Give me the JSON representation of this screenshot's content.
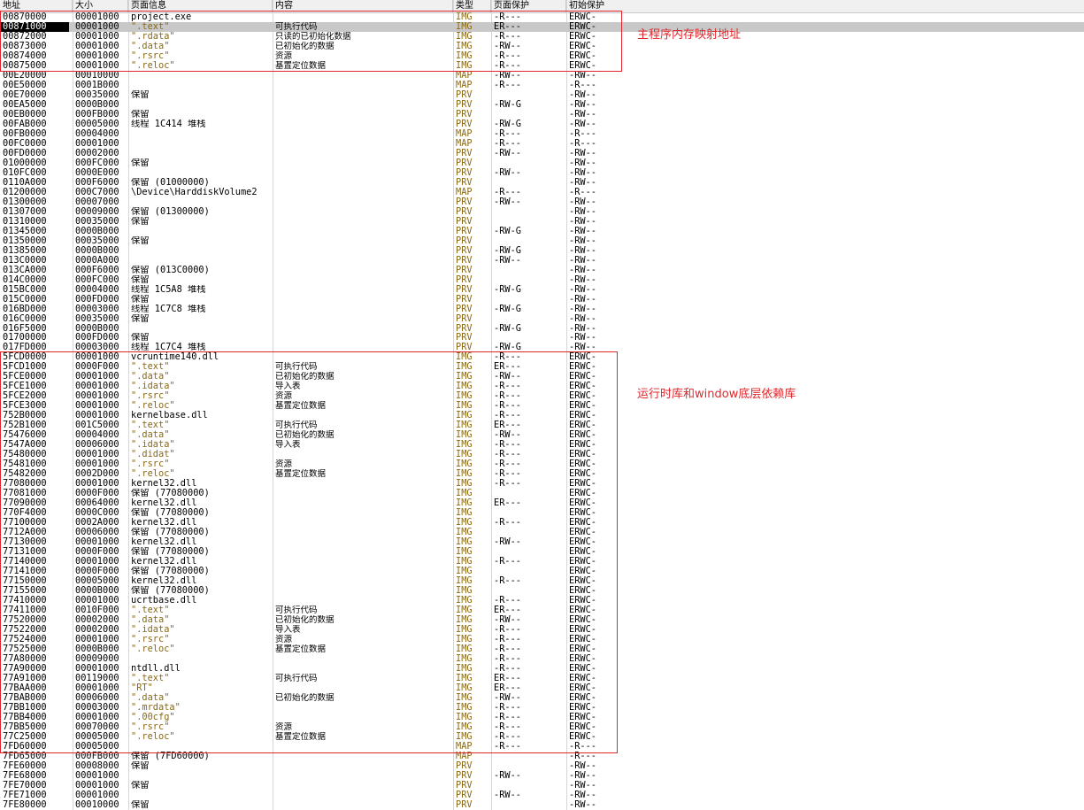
{
  "columns": {
    "address": "地址",
    "size": "大小",
    "page_info": "页面信息",
    "content": "内容",
    "type": "类型",
    "protection": "页面保护",
    "initial_protection": "初始保护"
  },
  "annotations": {
    "main_module": "主程序内存映射地址",
    "runtime_libs": "运行时库和window底层依赖库"
  },
  "colors": {
    "annotation": "#e0262b",
    "selection": "#c8c8c8",
    "type_text": "#8b6914"
  },
  "rows": [
    {
      "addr": "00870000",
      "size": "00001000",
      "info": "project.exe",
      "content": "",
      "type": "IMG",
      "prot": "-R---",
      "init": "ERWC-"
    },
    {
      "addr": "00871000",
      "size": "00001000",
      "info": " \".text\"",
      "content": "可执行代码",
      "type": "IMG",
      "prot": "ER---",
      "init": "ERWC-",
      "selected": true
    },
    {
      "addr": "00872000",
      "size": "00001000",
      "info": " \".rdata\"",
      "content": "只读的已初始化数据",
      "type": "IMG",
      "prot": "-R---",
      "init": "ERWC-"
    },
    {
      "addr": "00873000",
      "size": "00001000",
      "info": " \".data\"",
      "content": "已初始化的数据",
      "type": "IMG",
      "prot": "-RW--",
      "init": "ERWC-"
    },
    {
      "addr": "00874000",
      "size": "00001000",
      "info": " \".rsrc\"",
      "content": "资源",
      "type": "IMG",
      "prot": "-R---",
      "init": "ERWC-"
    },
    {
      "addr": "00875000",
      "size": "00001000",
      "info": " \".reloc\"",
      "content": "基置定位数据",
      "type": "IMG",
      "prot": "-R---",
      "init": "ERWC-"
    },
    {
      "addr": "00E20000",
      "size": "00010000",
      "info": "",
      "content": "",
      "type": "MAP",
      "prot": "-RW--",
      "init": "-RW--"
    },
    {
      "addr": "00E50000",
      "size": "0001B000",
      "info": "",
      "content": "",
      "type": "MAP",
      "prot": "-R---",
      "init": "-R---"
    },
    {
      "addr": "00E70000",
      "size": "00035000",
      "info": "保留",
      "content": "",
      "type": "PRV",
      "prot": "",
      "init": "-RW--"
    },
    {
      "addr": "00EA5000",
      "size": "0000B000",
      "info": "",
      "content": "",
      "type": "PRV",
      "prot": "-RW-G",
      "init": "-RW--"
    },
    {
      "addr": "00EB0000",
      "size": "000FB000",
      "info": "保留",
      "content": "",
      "type": "PRV",
      "prot": "",
      "init": "-RW--"
    },
    {
      "addr": "00FAB000",
      "size": "00005000",
      "info": "线程 1C414 堆栈",
      "content": "",
      "type": "PRV",
      "prot": "-RW-G",
      "init": "-RW--"
    },
    {
      "addr": "00FB0000",
      "size": "00004000",
      "info": "",
      "content": "",
      "type": "MAP",
      "prot": "-R---",
      "init": "-R---"
    },
    {
      "addr": "00FC0000",
      "size": "00001000",
      "info": "",
      "content": "",
      "type": "MAP",
      "prot": "-R---",
      "init": "-R---"
    },
    {
      "addr": "00FD0000",
      "size": "00002000",
      "info": "",
      "content": "",
      "type": "PRV",
      "prot": "-RW--",
      "init": "-RW--"
    },
    {
      "addr": "01000000",
      "size": "000FC000",
      "info": "保留",
      "content": "",
      "type": "PRV",
      "prot": "",
      "init": "-RW--"
    },
    {
      "addr": "010FC000",
      "size": "0000E000",
      "info": "",
      "content": "",
      "type": "PRV",
      "prot": "-RW--",
      "init": "-RW--"
    },
    {
      "addr": "0110A000",
      "size": "000F6000",
      "info": "保留 (01000000)",
      "content": "",
      "type": "PRV",
      "prot": "",
      "init": "-RW--"
    },
    {
      "addr": "01200000",
      "size": "000C7000",
      "info": "\\Device\\HarddiskVolume2",
      "content": "",
      "type": "MAP",
      "prot": "-R---",
      "init": "-R---"
    },
    {
      "addr": "01300000",
      "size": "00007000",
      "info": "",
      "content": "",
      "type": "PRV",
      "prot": "-RW--",
      "init": "-RW--"
    },
    {
      "addr": "01307000",
      "size": "00009000",
      "info": "保留 (01300000)",
      "content": "",
      "type": "PRV",
      "prot": "",
      "init": "-RW--"
    },
    {
      "addr": "01310000",
      "size": "00035000",
      "info": "保留",
      "content": "",
      "type": "PRV",
      "prot": "",
      "init": "-RW--"
    },
    {
      "addr": "01345000",
      "size": "0000B000",
      "info": "",
      "content": "",
      "type": "PRV",
      "prot": "-RW-G",
      "init": "-RW--"
    },
    {
      "addr": "01350000",
      "size": "00035000",
      "info": "保留",
      "content": "",
      "type": "PRV",
      "prot": "",
      "init": "-RW--"
    },
    {
      "addr": "01385000",
      "size": "0000B000",
      "info": "",
      "content": "",
      "type": "PRV",
      "prot": "-RW-G",
      "init": "-RW--"
    },
    {
      "addr": "013C0000",
      "size": "0000A000",
      "info": "",
      "content": "",
      "type": "PRV",
      "prot": "-RW--",
      "init": "-RW--"
    },
    {
      "addr": "013CA000",
      "size": "000F6000",
      "info": "保留 (013C0000)",
      "content": "",
      "type": "PRV",
      "prot": "",
      "init": "-RW--"
    },
    {
      "addr": "014C0000",
      "size": "000FC000",
      "info": "保留",
      "content": "",
      "type": "PRV",
      "prot": "",
      "init": "-RW--"
    },
    {
      "addr": "015BC000",
      "size": "00004000",
      "info": "线程 1C5A8 堆栈",
      "content": "",
      "type": "PRV",
      "prot": "-RW-G",
      "init": "-RW--"
    },
    {
      "addr": "015C0000",
      "size": "000FD000",
      "info": "保留",
      "content": "",
      "type": "PRV",
      "prot": "",
      "init": "-RW--"
    },
    {
      "addr": "016BD000",
      "size": "00003000",
      "info": "线程 1C7C8 堆栈",
      "content": "",
      "type": "PRV",
      "prot": "-RW-G",
      "init": "-RW--"
    },
    {
      "addr": "016C0000",
      "size": "00035000",
      "info": "保留",
      "content": "",
      "type": "PRV",
      "prot": "",
      "init": "-RW--"
    },
    {
      "addr": "016F5000",
      "size": "0000B000",
      "info": "",
      "content": "",
      "type": "PRV",
      "prot": "-RW-G",
      "init": "-RW--"
    },
    {
      "addr": "01700000",
      "size": "000FD000",
      "info": "保留",
      "content": "",
      "type": "PRV",
      "prot": "",
      "init": "-RW--"
    },
    {
      "addr": "017FD000",
      "size": "00003000",
      "info": "线程 1C7C4 堆栈",
      "content": "",
      "type": "PRV",
      "prot": "-RW-G",
      "init": "-RW--"
    },
    {
      "addr": "5FCD0000",
      "size": "00001000",
      "info": "vcruntime140.dll",
      "content": "",
      "type": "IMG",
      "prot": "-R---",
      "init": "ERWC-"
    },
    {
      "addr": "5FCD1000",
      "size": "0000F000",
      "info": " \".text\"",
      "content": "可执行代码",
      "type": "IMG",
      "prot": "ER---",
      "init": "ERWC-"
    },
    {
      "addr": "5FCE0000",
      "size": "00001000",
      "info": " \".data\"",
      "content": "已初始化的数据",
      "type": "IMG",
      "prot": "-RW--",
      "init": "ERWC-"
    },
    {
      "addr": "5FCE1000",
      "size": "00001000",
      "info": " \".idata\"",
      "content": "导入表",
      "type": "IMG",
      "prot": "-R---",
      "init": "ERWC-"
    },
    {
      "addr": "5FCE2000",
      "size": "00001000",
      "info": " \".rsrc\"",
      "content": "资源",
      "type": "IMG",
      "prot": "-R---",
      "init": "ERWC-"
    },
    {
      "addr": "5FCE3000",
      "size": "00001000",
      "info": " \".reloc\"",
      "content": "基置定位数据",
      "type": "IMG",
      "prot": "-R---",
      "init": "ERWC-"
    },
    {
      "addr": "752B0000",
      "size": "00001000",
      "info": "kernelbase.dll",
      "content": "",
      "type": "IMG",
      "prot": "-R---",
      "init": "ERWC-"
    },
    {
      "addr": "752B1000",
      "size": "001C5000",
      "info": " \".text\"",
      "content": "可执行代码",
      "type": "IMG",
      "prot": "ER---",
      "init": "ERWC-"
    },
    {
      "addr": "75476000",
      "size": "00004000",
      "info": " \".data\"",
      "content": "已初始化的数据",
      "type": "IMG",
      "prot": "-RW--",
      "init": "ERWC-"
    },
    {
      "addr": "7547A000",
      "size": "00006000",
      "info": " \".idata\"",
      "content": "导入表",
      "type": "IMG",
      "prot": "-R---",
      "init": "ERWC-"
    },
    {
      "addr": "75480000",
      "size": "00001000",
      "info": " \".didat\"",
      "content": "",
      "type": "IMG",
      "prot": "-R---",
      "init": "ERWC-"
    },
    {
      "addr": "75481000",
      "size": "00001000",
      "info": " \".rsrc\"",
      "content": "资源",
      "type": "IMG",
      "prot": "-R---",
      "init": "ERWC-"
    },
    {
      "addr": "75482000",
      "size": "0002D000",
      "info": " \".reloc\"",
      "content": "基置定位数据",
      "type": "IMG",
      "prot": "-R---",
      "init": "ERWC-"
    },
    {
      "addr": "77080000",
      "size": "00001000",
      "info": "kernel32.dll",
      "content": "",
      "type": "IMG",
      "prot": "-R---",
      "init": "ERWC-"
    },
    {
      "addr": "77081000",
      "size": "0000F000",
      "info": "保留 (77080000)",
      "content": "",
      "type": "IMG",
      "prot": "",
      "init": "ERWC-"
    },
    {
      "addr": "77090000",
      "size": "00064000",
      "info": "kernel32.dll",
      "content": "",
      "type": "IMG",
      "prot": "ER---",
      "init": "ERWC-"
    },
    {
      "addr": "770F4000",
      "size": "0000C000",
      "info": "保留 (77080000)",
      "content": "",
      "type": "IMG",
      "prot": "",
      "init": "ERWC-"
    },
    {
      "addr": "77100000",
      "size": "0002A000",
      "info": "kernel32.dll",
      "content": "",
      "type": "IMG",
      "prot": "-R---",
      "init": "ERWC-"
    },
    {
      "addr": "7712A000",
      "size": "00006000",
      "info": "保留 (77080000)",
      "content": "",
      "type": "IMG",
      "prot": "",
      "init": "ERWC-"
    },
    {
      "addr": "77130000",
      "size": "00001000",
      "info": "kernel32.dll",
      "content": "",
      "type": "IMG",
      "prot": "-RW--",
      "init": "ERWC-"
    },
    {
      "addr": "77131000",
      "size": "0000F000",
      "info": "保留 (77080000)",
      "content": "",
      "type": "IMG",
      "prot": "",
      "init": "ERWC-"
    },
    {
      "addr": "77140000",
      "size": "00001000",
      "info": "kernel32.dll",
      "content": "",
      "type": "IMG",
      "prot": "-R---",
      "init": "ERWC-"
    },
    {
      "addr": "77141000",
      "size": "0000F000",
      "info": "保留 (77080000)",
      "content": "",
      "type": "IMG",
      "prot": "",
      "init": "ERWC-"
    },
    {
      "addr": "77150000",
      "size": "00005000",
      "info": "kernel32.dll",
      "content": "",
      "type": "IMG",
      "prot": "-R---",
      "init": "ERWC-"
    },
    {
      "addr": "77155000",
      "size": "0000B000",
      "info": "保留 (77080000)",
      "content": "",
      "type": "IMG",
      "prot": "",
      "init": "ERWC-"
    },
    {
      "addr": "77410000",
      "size": "00001000",
      "info": "ucrtbase.dll",
      "content": "",
      "type": "IMG",
      "prot": "-R---",
      "init": "ERWC-"
    },
    {
      "addr": "77411000",
      "size": "0010F000",
      "info": " \".text\"",
      "content": "可执行代码",
      "type": "IMG",
      "prot": "ER---",
      "init": "ERWC-"
    },
    {
      "addr": "77520000",
      "size": "00002000",
      "info": " \".data\"",
      "content": "已初始化的数据",
      "type": "IMG",
      "prot": "-RW--",
      "init": "ERWC-"
    },
    {
      "addr": "77522000",
      "size": "00002000",
      "info": " \".idata\"",
      "content": "导入表",
      "type": "IMG",
      "prot": "-R---",
      "init": "ERWC-"
    },
    {
      "addr": "77524000",
      "size": "00001000",
      "info": " \".rsrc\"",
      "content": "资源",
      "type": "IMG",
      "prot": "-R---",
      "init": "ERWC-"
    },
    {
      "addr": "77525000",
      "size": "0000B000",
      "info": " \".reloc\"",
      "content": "基置定位数据",
      "type": "IMG",
      "prot": "-R---",
      "init": "ERWC-"
    },
    {
      "addr": "77A80000",
      "size": "00009000",
      "info": "",
      "content": "",
      "type": "IMG",
      "prot": "-R---",
      "init": "ERWC-"
    },
    {
      "addr": "77A90000",
      "size": "00001000",
      "info": "ntdll.dll",
      "content": "",
      "type": "IMG",
      "prot": "-R---",
      "init": "ERWC-"
    },
    {
      "addr": "77A91000",
      "size": "00119000",
      "info": " \".text\"",
      "content": "可执行代码",
      "type": "IMG",
      "prot": "ER---",
      "init": "ERWC-"
    },
    {
      "addr": "77BAA000",
      "size": "00001000",
      "info": " \"RT\"",
      "content": "",
      "type": "IMG",
      "prot": "ER---",
      "init": "ERWC-"
    },
    {
      "addr": "77BAB000",
      "size": "00006000",
      "info": " \".data\"",
      "content": "已初始化的数据",
      "type": "IMG",
      "prot": "-RW--",
      "init": "ERWC-"
    },
    {
      "addr": "77BB1000",
      "size": "00003000",
      "info": " \".mrdata\"",
      "content": "",
      "type": "IMG",
      "prot": "-R---",
      "init": "ERWC-"
    },
    {
      "addr": "77BB4000",
      "size": "00001000",
      "info": " \".00cfg\"",
      "content": "",
      "type": "IMG",
      "prot": "-R---",
      "init": "ERWC-"
    },
    {
      "addr": "77BB5000",
      "size": "00070000",
      "info": " \".rsrc\"",
      "content": "资源",
      "type": "IMG",
      "prot": "-R---",
      "init": "ERWC-"
    },
    {
      "addr": "77C25000",
      "size": "00005000",
      "info": " \".reloc\"",
      "content": "基置定位数据",
      "type": "IMG",
      "prot": "-R---",
      "init": "ERWC-"
    },
    {
      "addr": "7FD60000",
      "size": "00005000",
      "info": "",
      "content": "",
      "type": "MAP",
      "prot": "-R---",
      "init": "-R---"
    },
    {
      "addr": "7FD65000",
      "size": "000FB000",
      "info": "保留 (7FD60000)",
      "content": "",
      "type": "MAP",
      "prot": "",
      "init": "-R---"
    },
    {
      "addr": "7FE60000",
      "size": "00008000",
      "info": "保留",
      "content": "",
      "type": "PRV",
      "prot": "",
      "init": "-RW--"
    },
    {
      "addr": "7FE68000",
      "size": "00001000",
      "info": "",
      "content": "",
      "type": "PRV",
      "prot": "-RW--",
      "init": "-RW--"
    },
    {
      "addr": "7FE70000",
      "size": "00001000",
      "info": "保留",
      "content": "",
      "type": "PRV",
      "prot": "",
      "init": "-RW--"
    },
    {
      "addr": "7FE71000",
      "size": "00001000",
      "info": "",
      "content": "",
      "type": "PRV",
      "prot": "-RW--",
      "init": "-RW--"
    },
    {
      "addr": "7FE80000",
      "size": "00010000",
      "info": "保留",
      "content": "",
      "type": "PRV",
      "prot": "",
      "init": "-RW--"
    }
  ]
}
